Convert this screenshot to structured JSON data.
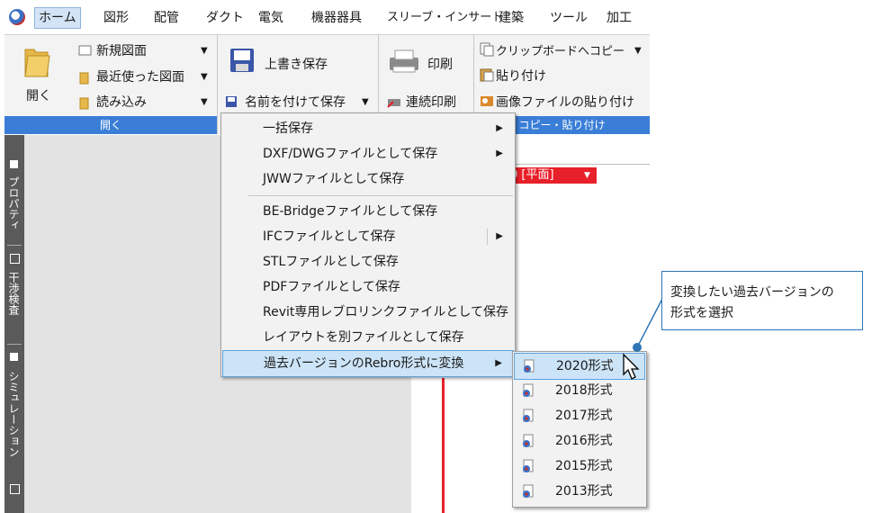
{
  "menubar": {
    "tabs": [
      "ホーム",
      "図形",
      "配管",
      "ダクト",
      "電気",
      "機器器具",
      "スリーブ・インサート",
      "建築",
      "ツール",
      "加工"
    ]
  },
  "ribbon": {
    "open_group": {
      "open_label": "開く",
      "new_drawing": "新規図面",
      "recent": "最近使った図面",
      "import": "読み込み",
      "footer": "開く"
    },
    "save_group": {
      "overwrite_save": "上書き保存",
      "save_as": "名前を付けて保存"
    },
    "print_group": {
      "print": "印刷",
      "continuous_print": "連続印刷"
    },
    "clipboard_group": {
      "copy_to_clipboard": "クリップボードへコピー",
      "paste": "貼り付け",
      "paste_image": "画像ファイルの貼り付け",
      "footer": "コピー・貼り付け"
    }
  },
  "side_panels": [
    "プロパティ",
    "干渉検査",
    "シミュレーション"
  ],
  "view_tab": "0 [平面]",
  "save_menu": {
    "items": [
      {
        "label": "一括保存",
        "has_submenu": true
      },
      {
        "label": "DXF/DWGファイルとして保存",
        "has_submenu": true
      },
      {
        "label": "JWWファイルとして保存",
        "has_submenu": false
      },
      {
        "label": "BE-Bridgeファイルとして保存",
        "has_submenu": false
      },
      {
        "label": "IFCファイルとして保存",
        "has_submenu": true
      },
      {
        "label": "STLファイルとして保存",
        "has_submenu": false
      },
      {
        "label": "PDFファイルとして保存",
        "has_submenu": false
      },
      {
        "label": "Revit専用レブロリンクファイルとして保存",
        "has_submenu": false
      },
      {
        "label": "レイアウトを別ファイルとして保存",
        "has_submenu": false
      },
      {
        "label": "過去バージョンのRebro形式に変換",
        "has_submenu": true
      }
    ]
  },
  "version_submenu": {
    "items": [
      "2020形式",
      "2018形式",
      "2017形式",
      "2016形式",
      "2015形式",
      "2013形式"
    ]
  },
  "callout": {
    "line1": "変換したい過去バージョンの",
    "line2": "形式を選択"
  },
  "colors": {
    "accent": "#3a7ed7",
    "highlight": "#cce4f7",
    "callout_border": "#2e75b6",
    "drawing_red": "#e8202a"
  }
}
